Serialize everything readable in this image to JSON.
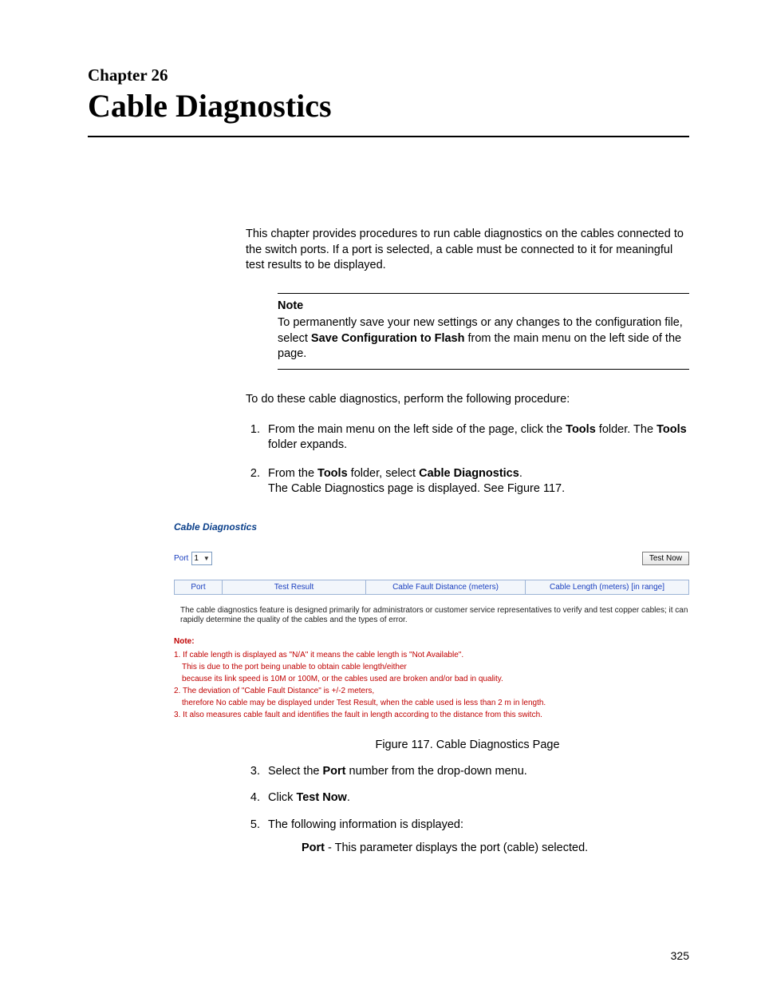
{
  "chapter": {
    "label": "Chapter 26",
    "title": "Cable Diagnostics"
  },
  "intro": "This chapter provides procedures to run cable diagnostics on the cables connected to the switch ports. If a port is selected, a cable must be connected to it for meaningful test results to be displayed.",
  "note": {
    "label": "Note",
    "pre": "To permanently save your new settings or any changes to the configuration file, select ",
    "bold": "Save Configuration to Flash",
    "post": " from the main menu on the left side of the page."
  },
  "lead": "To do these cable diagnostics, perform the following procedure:",
  "steps": {
    "s1a": "From the main menu on the left side of the page, click the ",
    "s1b": "Tools",
    "s1c": " folder. The ",
    "s1d": "Tools",
    "s1e": " folder expands.",
    "s2a": "From the ",
    "s2b": "Tools",
    "s2c": " folder, select ",
    "s2d": "Cable Diagnostics",
    "s2e": ".",
    "s2f": "The Cable Diagnostics page is displayed. See Figure 117."
  },
  "shot": {
    "title": "Cable Diagnostics",
    "port_label": "Port",
    "port_value": "1",
    "test_btn": "Test Now",
    "headers": {
      "c1": "Port",
      "c2": "Test Result",
      "c3": "Cable Fault Distance (meters)",
      "c4": "Cable Length (meters) [in range]"
    },
    "desc": "The cable diagnostics feature is designed primarily for administrators or customer service representatives to verify and test copper cables; it can rapidly determine the quality of the cables and the types of error.",
    "note_hd": "Note:",
    "n1": "1. If cable length is displayed as \"N/A\" it means the cable length is \"Not Available\".",
    "n1a": "This is due to the port being unable to obtain cable length/either",
    "n1b": "because its link speed is 10M or 100M, or the cables used are broken and/or bad in quality.",
    "n2": "2. The deviation of \"Cable Fault Distance\" is +/-2 meters,",
    "n2a": "therefore No cable may be displayed under Test Result, when the cable used is less than 2 m in length.",
    "n3": "3. It also measures cable fault and identifies the fault in length according to the distance from this switch."
  },
  "fig_caption": "Figure 117. Cable Diagnostics Page",
  "steps2": {
    "s3a": "Select the ",
    "s3b": "Port",
    "s3c": " number from the drop-down menu.",
    "s4a": "Click ",
    "s4b": "Test Now",
    "s4c": ".",
    "s5": "The following information is displayed:",
    "s5sub_b": "Port",
    "s5sub": " - This parameter displays the port (cable) selected."
  },
  "page_number": "325"
}
